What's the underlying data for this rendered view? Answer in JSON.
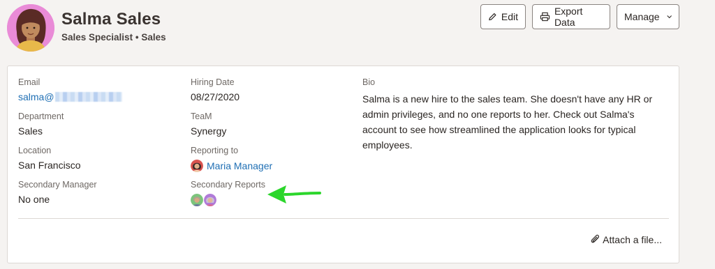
{
  "profile": {
    "name": "Salma Sales",
    "title": "Sales Specialist",
    "separator": "•",
    "department": "Sales"
  },
  "actions": {
    "edit_label": "Edit",
    "export_label": "Export Data",
    "manage_label": "Manage"
  },
  "fields": {
    "email": {
      "label": "Email",
      "value": "salma@"
    },
    "hiring_date": {
      "label": "Hiring Date",
      "value": "08/27/2020"
    },
    "department": {
      "label": "Department",
      "value": "Sales"
    },
    "team": {
      "label": "TeaM",
      "value": "Synergy"
    },
    "location": {
      "label": "Location",
      "value": "San Francisco"
    },
    "reporting_to": {
      "label": "Reporting to",
      "value": "Maria Manager"
    },
    "secondary_manager": {
      "label": "Secondary Manager",
      "value": "No one"
    },
    "secondary_reports": {
      "label": "Secondary Reports"
    },
    "bio": {
      "label": "Bio",
      "value": "Salma is a new hire to the sales team. She doesn't have any HR or admin privileges, and no one reports to her. Check out Salma's account to see how streamlined the application looks for typical employees."
    }
  },
  "attach_label": "Attach a file...",
  "colors": {
    "accent_link": "#1f6fb4",
    "arrow": "#2bd62b",
    "avatar_bg": "#e98bd7"
  },
  "icons": [
    "pencil-icon",
    "printer-icon",
    "chevron-down-icon",
    "paperclip-icon",
    "arrow-left-icon"
  ]
}
